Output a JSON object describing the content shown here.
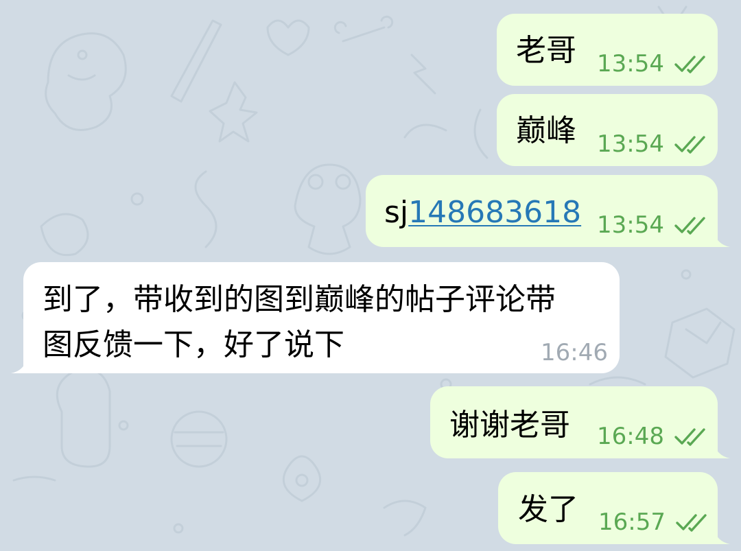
{
  "chat": {
    "messages": [
      {
        "direction": "outgoing",
        "text": "老哥",
        "time": "13:54",
        "status": "read"
      },
      {
        "direction": "outgoing",
        "text": "巅峰",
        "time": "13:54",
        "status": "read"
      },
      {
        "direction": "outgoing",
        "text_prefix": "sj",
        "link": "148683618",
        "time": "13:54",
        "status": "read"
      },
      {
        "direction": "incoming",
        "line1": "到了，带收到的图到巅峰的帖子评论带",
        "line2": "图反馈一下，好了说下",
        "time": "16:46"
      },
      {
        "direction": "outgoing",
        "text": "谢谢老哥",
        "time": "16:48",
        "status": "read"
      },
      {
        "direction": "outgoing",
        "text": "发了",
        "time": "16:57",
        "status": "read"
      }
    ]
  },
  "colors": {
    "background": "#d1dbe4",
    "outgoing_bubble": "#eeffde",
    "incoming_bubble": "#ffffff",
    "outgoing_time": "#5aa853",
    "incoming_time": "#a1aab3",
    "link": "#2678b6"
  },
  "icons": {
    "read_status": "double-check-icon",
    "wallpaper": "doodle-pattern"
  }
}
